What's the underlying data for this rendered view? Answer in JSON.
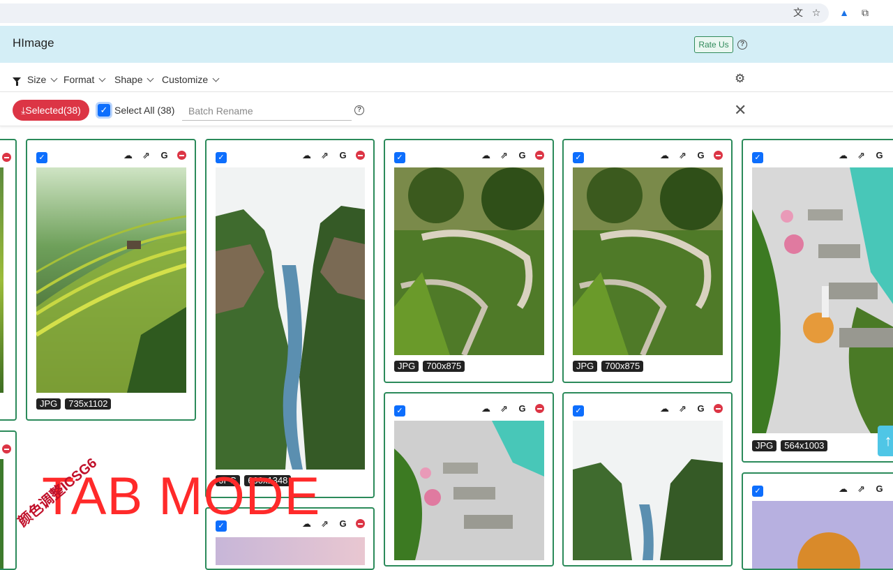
{
  "browser": {
    "icons": [
      "translate-icon",
      "star-icon",
      "extension-hImage-icon",
      "puzzle-icon"
    ]
  },
  "header": {
    "title": "HImage",
    "rate_label": "Rate Us",
    "help": "?"
  },
  "filters": {
    "size_label": "Size",
    "format_label": "Format",
    "shape_label": "Shape",
    "customize_label": "Customize"
  },
  "actions": {
    "download_label": "Selected(38)",
    "select_all_label": "Select All (38)",
    "rename_placeholder": "Batch Rename",
    "help": "?"
  },
  "cards": [
    {
      "format": "JPG",
      "dims": "735x1102"
    },
    {
      "format": "JPG",
      "dims": "660x1348"
    },
    {
      "format": "JPG",
      "dims": "700x875"
    },
    {
      "format": "JPG",
      "dims": "700x875"
    },
    {
      "format": "JPG",
      "dims": "564x1003"
    }
  ],
  "watermark": {
    "big": "TAB MODE",
    "small": "颜色调整ICSG6"
  },
  "colors": {
    "accent_green": "#2b8a5a",
    "danger": "#dc3545",
    "primary": "#0d6efd",
    "header_bg": "#d4eef6"
  }
}
